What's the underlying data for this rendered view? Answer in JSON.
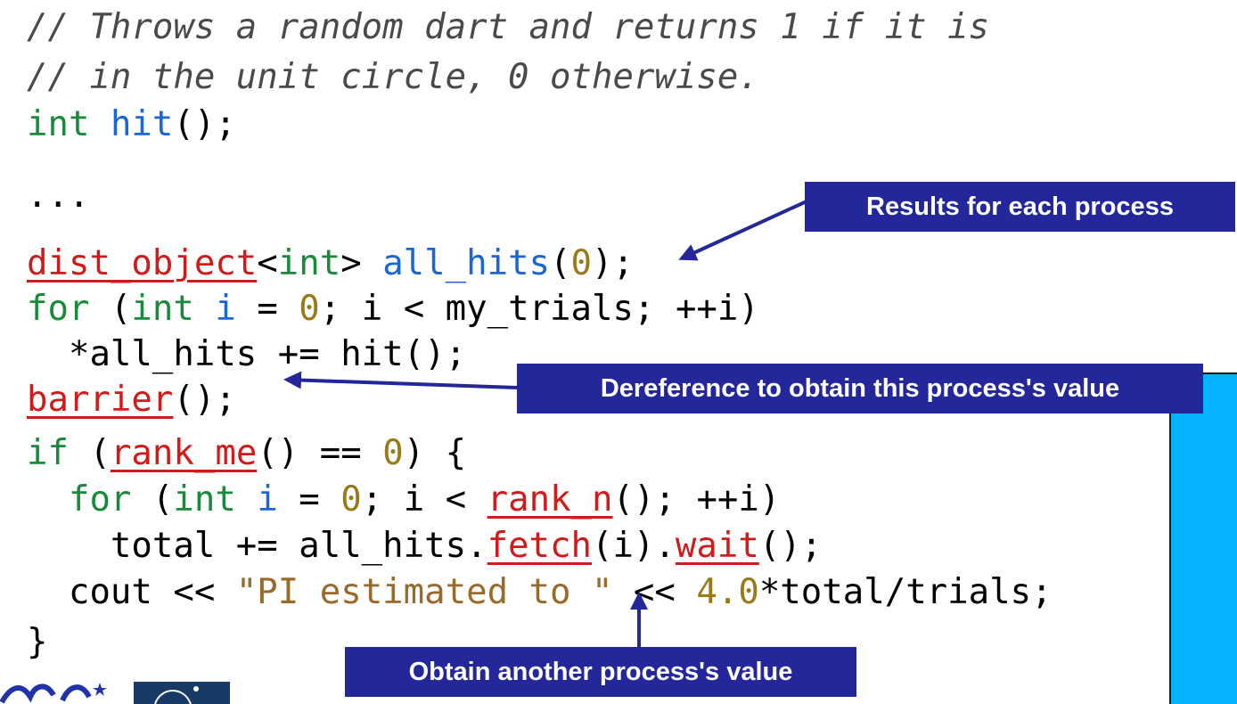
{
  "code": {
    "l1": "// Throws a random dart and returns 1 if it is",
    "l2": "// in the unit circle, 0 otherwise.",
    "l3": {
      "type": "int",
      "name": "hit",
      "rest": "();"
    },
    "l4": "...",
    "l5": {
      "lib": "dist_object",
      "type_open": "<",
      "type": "int",
      "type_close": ">",
      "sp": " ",
      "var": "all_hits",
      "open": "(",
      "zero": "0",
      "close": ");"
    },
    "l6": {
      "for": "for",
      "open": " (",
      "int": "int",
      "sp": " ",
      "i": "i",
      "eq": " = ",
      "zero": "0",
      "rest": "; i < my_trials; ++i)"
    },
    "l7": "  *all_hits += hit();",
    "l8": {
      "lib": "barrier",
      "rest": "();"
    },
    "l9": {
      "if": "if",
      "open": " (",
      "lib": "rank_me",
      "mid": "() == ",
      "zero": "0",
      "rest": ") {"
    },
    "l10": {
      "indent": "  ",
      "for": "for",
      "open": " (",
      "int": "int",
      "sp": " ",
      "i": "i",
      "eq": " = ",
      "zero": "0",
      "mid": "; i < ",
      "lib": "rank_n",
      "rest": "(); ++i)"
    },
    "l11": {
      "pre": "    total += all_hits.",
      "lib1": "fetch",
      "mid": "(i).",
      "lib2": "wait",
      "rest": "();"
    },
    "l12": {
      "pre": "  cout << ",
      "str": "\"PI estimated to \"",
      "mid": " << ",
      "num": "4.0",
      "rest": "*total/trials;"
    },
    "l13": "}"
  },
  "callouts": {
    "results": "Results for each process",
    "dereference": "Dereference to obtain this process's value",
    "obtain": "Obtain another process's value"
  },
  "colors": {
    "callout_bg": "#23279a",
    "side_panel": "#05b4ff",
    "keyword": "#1a8a3a",
    "identifier": "#1a66d6",
    "number": "#9a7a18",
    "library": "#d11a1a"
  }
}
